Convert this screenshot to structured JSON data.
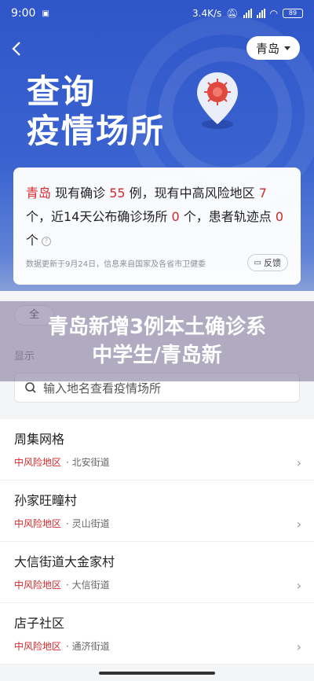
{
  "status_bar": {
    "time": "9:00",
    "network_speed": "3.4K/s",
    "battery": "89"
  },
  "header": {
    "back_icon": "chevron-left-icon",
    "city": "青岛"
  },
  "hero": {
    "title_line1": "查询",
    "title_line2": "疫情场所"
  },
  "summary": {
    "city": "青岛",
    "t1": " 现有确诊 ",
    "confirmed": "55",
    "t2": " 例，现有中高风险地区 ",
    "risk_areas": "7",
    "t3": " 个，近14天公布确诊场所 ",
    "places": "0",
    "t4": " 个，患者轨迹点 ",
    "tracks": "0",
    "t5": " 个",
    "source_note": "数据更新于9月24日，信息来自国家及各省市卫健委",
    "feedback_label": "反馈"
  },
  "filters": {
    "all_label": "全"
  },
  "display_label": "显示",
  "overlay": {
    "headline": "青岛新增3例本土确诊系中学生/青岛新"
  },
  "search": {
    "placeholder": "输入地名查看疫情场所"
  },
  "places": [
    {
      "name": "周集网格",
      "risk": "中风险地区",
      "street": "· 北安街道"
    },
    {
      "name": "孙家旺疃村",
      "risk": "中风险地区",
      "street": "· 灵山街道"
    },
    {
      "name": "大信街道大金家村",
      "risk": "中风险地区",
      "street": "· 大信街道"
    },
    {
      "name": "店子社区",
      "risk": "中风险地区",
      "street": "· 通济街道"
    }
  ],
  "colors": {
    "hero": "#3a63d0",
    "risk_red": "#d4292b"
  }
}
